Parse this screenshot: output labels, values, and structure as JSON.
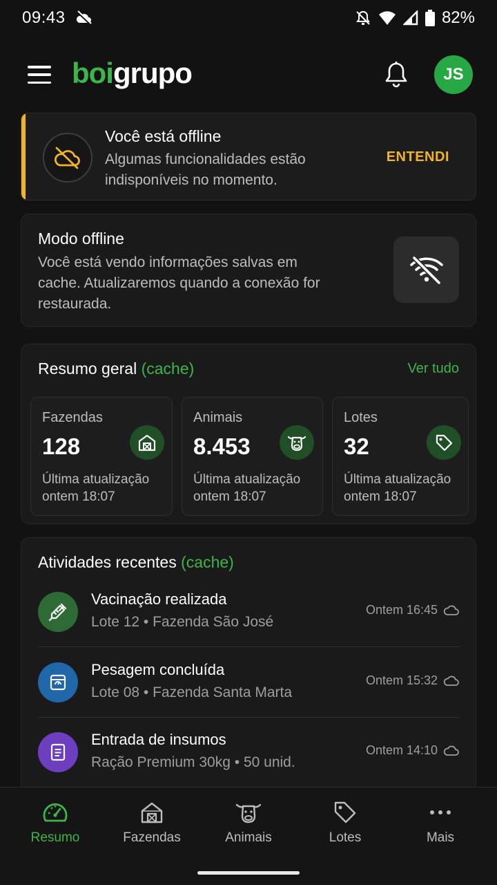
{
  "status_bar": {
    "time": "09:43",
    "battery": "82%"
  },
  "app": {
    "logo_part1": "boi",
    "logo_part2": "grupo",
    "avatar_initials": "JS"
  },
  "offline_banner": {
    "title": "Você está offline",
    "description": "Algumas funcionalidades estão indisponíveis no momento.",
    "action": "ENTENDI"
  },
  "offline_mode": {
    "title": "Modo offline",
    "description": "Você está vendo informações salvas em cache. Atualizaremos quando a conexão for restaurada."
  },
  "summary": {
    "title": "Resumo geral",
    "tag": "(cache)",
    "see_all": "Ver tudo",
    "stats": [
      {
        "label": "Fazendas",
        "value": "128",
        "update_label": "Última atualização",
        "update_time": "ontem 18:07",
        "icon": "barn-icon"
      },
      {
        "label": "Animais",
        "value": "8.453",
        "update_label": "Última atualização",
        "update_time": "ontem 18:07",
        "icon": "cow-icon"
      },
      {
        "label": "Lotes",
        "value": "32",
        "update_label": "Última atualização",
        "update_time": "ontem 18:07",
        "icon": "tag-icon"
      }
    ]
  },
  "activities": {
    "title": "Atividades recentes",
    "tag": "(cache)",
    "items": [
      {
        "title": "Vacinação realizada",
        "subtitle": "Lote 12 • Fazenda São José",
        "time": "Ontem 16:45",
        "icon": "syringe-icon",
        "color": "#2e6b34"
      },
      {
        "title": "Pesagem concluída",
        "subtitle": "Lote 08 • Fazenda Santa Marta",
        "time": "Ontem 15:32",
        "icon": "scale-icon",
        "color": "#1f67a8"
      },
      {
        "title": "Entrada de insumos",
        "subtitle": "Ração Premium 30kg • 50 unid.",
        "time": "Ontem 14:10",
        "icon": "document-icon",
        "color": "#6d3fc0"
      }
    ]
  },
  "bottom_nav": [
    {
      "label": "Resumo",
      "icon": "dashboard-icon",
      "active": true
    },
    {
      "label": "Fazendas",
      "icon": "barn-icon",
      "active": false
    },
    {
      "label": "Animais",
      "icon": "cow-icon",
      "active": false
    },
    {
      "label": "Lotes",
      "icon": "tag-icon",
      "active": false
    },
    {
      "label": "Mais",
      "icon": "more-icon",
      "active": false
    }
  ],
  "colors": {
    "accent": "#3db54a",
    "warning": "#f0b429",
    "background": "#121212"
  }
}
